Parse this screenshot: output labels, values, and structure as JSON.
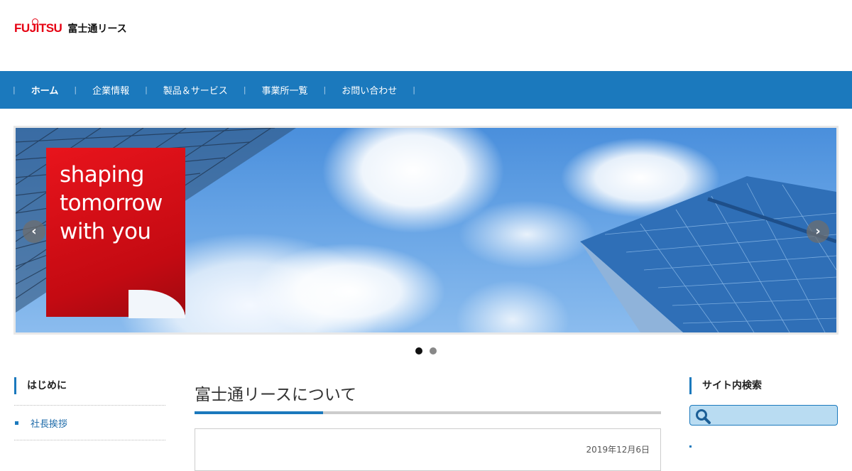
{
  "header": {
    "logo_mark": "FUJITSU",
    "logo_name": "富士通リース"
  },
  "nav": {
    "items": [
      {
        "label": "ホーム",
        "active": true
      },
      {
        "label": "企業情報",
        "active": false
      },
      {
        "label": "製品＆サービス",
        "active": false
      },
      {
        "label": "事業所一覧",
        "active": false
      },
      {
        "label": "お問い合わせ",
        "active": false
      }
    ],
    "separator": "|"
  },
  "slider": {
    "tagline": "shaping\ntomorrow\nwith you",
    "prev_icon": "chevron-left-icon",
    "next_icon": "chevron-right-icon",
    "prev_glyph": "‹",
    "next_glyph": "›",
    "slide_count": 2,
    "active_slide": 1
  },
  "left_sidebar": {
    "heading": "はじめに",
    "links": [
      "社長挨拶"
    ]
  },
  "main": {
    "title": "富士通リースについて",
    "date": "2019年12月6日"
  },
  "right_sidebar": {
    "heading": "サイト内検索",
    "search_icon": "search-icon"
  },
  "colors": {
    "brand_blue": "#1b79bd",
    "brand_red": "#e60012",
    "search_bg": "#b9dcf2"
  }
}
